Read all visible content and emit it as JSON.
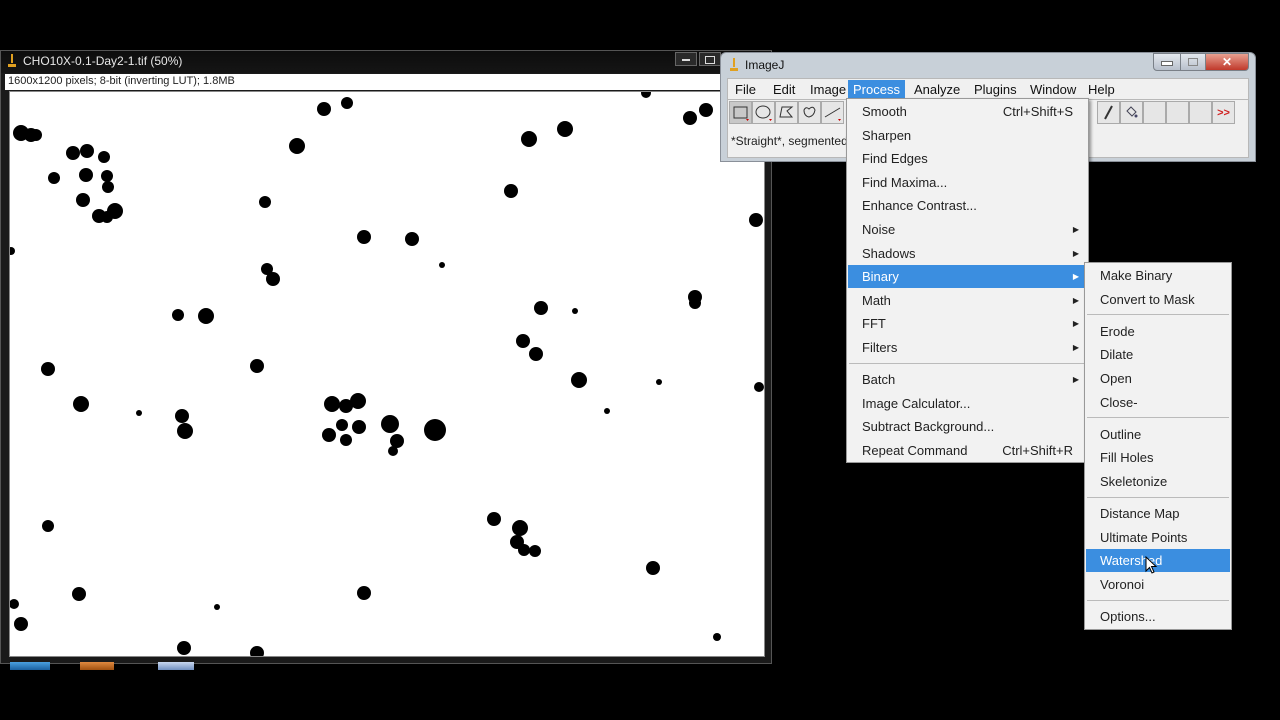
{
  "image_window": {
    "title": "CHO10X-0.1-Day2-1.tif (50%)",
    "info": "1600x1200 pixels; 8-bit (inverting LUT); 1.8MB"
  },
  "imagej_window": {
    "title": "ImageJ",
    "menubar": [
      "File",
      "Edit",
      "Image",
      "Process",
      "Analyze",
      "Plugins",
      "Window",
      "Help"
    ],
    "active_menu": "Process",
    "tools": [
      "rectangle-tool",
      "oval-tool",
      "polygon-tool",
      "freehand-tool",
      "line-tool"
    ],
    "right_tools": [
      "brush-tool",
      "flood-fill-tool",
      "",
      "",
      "",
      "more-tools"
    ],
    "more_label": ">>",
    "status": "*Straight*, segmented"
  },
  "process_menu": {
    "items": [
      {
        "label": "Smooth",
        "shortcut": "Ctrl+Shift+S"
      },
      {
        "label": "Sharpen"
      },
      {
        "label": "Find Edges"
      },
      {
        "label": "Find Maxima..."
      },
      {
        "label": "Enhance Contrast..."
      },
      {
        "label": "Noise",
        "submenu": true
      },
      {
        "label": "Shadows",
        "submenu": true
      },
      {
        "label": "Binary",
        "submenu": true,
        "highlighted": true
      },
      {
        "label": "Math",
        "submenu": true
      },
      {
        "label": "FFT",
        "submenu": true
      },
      {
        "label": "Filters",
        "submenu": true
      },
      {
        "label": "Batch",
        "submenu": true
      },
      {
        "label": "Image Calculator..."
      },
      {
        "label": "Subtract Background..."
      },
      {
        "label": "Repeat Command",
        "shortcut": "Ctrl+Shift+R"
      }
    ]
  },
  "binary_menu": {
    "items": [
      {
        "label": "Make Binary"
      },
      {
        "label": "Convert to Mask"
      },
      {
        "label": "Erode"
      },
      {
        "label": "Dilate"
      },
      {
        "label": "Open"
      },
      {
        "label": "Close-"
      },
      {
        "label": "Outline"
      },
      {
        "label": "Fill Holes"
      },
      {
        "label": "Skeletonize"
      },
      {
        "label": "Distance Map"
      },
      {
        "label": "Ultimate Points"
      },
      {
        "label": "Watershed",
        "highlighted": true
      },
      {
        "label": "Voronoi"
      },
      {
        "label": "Options..."
      }
    ]
  },
  "colors": {
    "highlight": "#3b8ee0",
    "menu_bg": "#f2f2f2",
    "more_arrow": "#d02020"
  }
}
